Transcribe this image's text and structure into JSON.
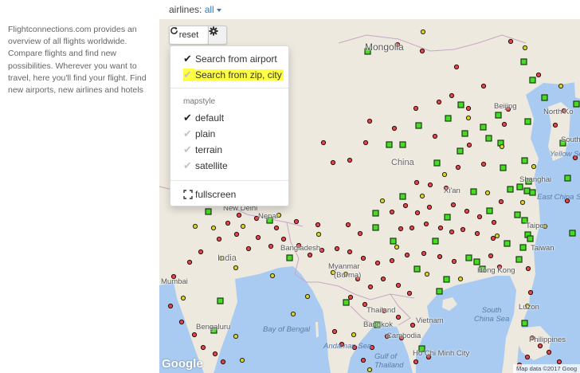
{
  "intro_text": "Flightconnections.com provides an overview of all flights worldwide. Compare flights and find new possibilities. Wherever you want to travel, here you'll find your flight. Find new airports, new airlines and hotels",
  "airlines_filter": {
    "label": "airlines:",
    "value": "all"
  },
  "map_controls": {
    "reset_label": "reset"
  },
  "menu": {
    "search_airport": "Search from airport",
    "search_zip": "Search from zip, city",
    "mapstyle_header": "mapstyle",
    "styles": [
      "default",
      "plain",
      "terrain",
      "satellite"
    ],
    "fullscreen": "fullscreen"
  },
  "map_labels": {
    "mongolia": "Mongolia",
    "china": "China",
    "india": "India",
    "myanmar": "Myanmar",
    "burma": "(Burma)",
    "thailand": "Thailand",
    "vietnam": "Vietnam",
    "cambodia": "Cambodia",
    "bangladesh": "Bangladesh",
    "beijing": "Beijing",
    "north_korea": "North Ko",
    "south_korea": "South",
    "yellow_sea": "Yellow Se",
    "shanghai": "Shanghai",
    "east_china_sea": "East China Se",
    "taipei": "Taipei",
    "taiwan": "Taiwan",
    "hong_kong": "Hong Kong",
    "south_china_sea": "South\nChina Sea",
    "bay_of_bengal": "Bay of Bengal",
    "andaman_sea": "Andaman Sea",
    "gulf_thailand": "Gulf of\nThailand",
    "mumbai": "Mumbai",
    "bengaluru": "Bengaluru",
    "bangkok": "Bangkok",
    "ho_chi_minh": "Ho Chi Minh City",
    "luzon": "Luzon",
    "philippines": "Philippines",
    "new_delhi": "New Delhi",
    "kathmandu": "Nepal",
    "xian": "Xi'an"
  },
  "google_logo": "Google",
  "attribution": "Map data ©2017 Goog",
  "colors": {
    "hub": "#44dd22",
    "airport": "#e2454a",
    "airport_yellow": "#d9d12c",
    "water": "#a9cbf1",
    "land": "#ede9df"
  }
}
